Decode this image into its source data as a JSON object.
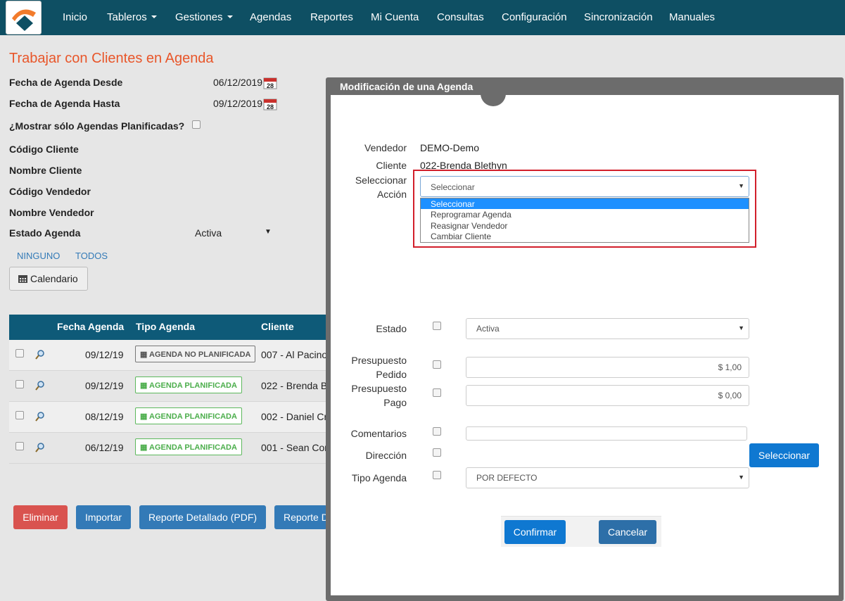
{
  "navbar": {
    "items": [
      {
        "label": "Inicio"
      },
      {
        "label": "Tableros",
        "dropdown": true
      },
      {
        "label": "Gestiones",
        "dropdown": true
      },
      {
        "label": "Agendas"
      },
      {
        "label": "Reportes"
      },
      {
        "label": "Mi Cuenta"
      },
      {
        "label": "Consultas"
      },
      {
        "label": "Configuración"
      },
      {
        "label": "Sincronización"
      },
      {
        "label": "Manuales"
      }
    ]
  },
  "page": {
    "title": "Trabajar con Clientes en Agenda",
    "filters": {
      "fecha_desde_label": "Fecha de Agenda Desde",
      "fecha_desde_value": "06/12/2019",
      "fecha_hasta_label": "Fecha de Agenda Hasta",
      "fecha_hasta_value": "09/12/2019",
      "solo_planificadas_label": "¿Mostrar sólo Agendas Planificadas?",
      "codigo_cliente_label": "Código Cliente",
      "nombre_cliente_label": "Nombre Cliente",
      "codigo_vendedor_label": "Código Vendedor",
      "nombre_vendedor_label": "Nombre Vendedor",
      "estado_agenda_label": "Estado Agenda",
      "estado_agenda_value": "Activa",
      "calendar_day": "28"
    },
    "ninguno_label": "NINGUNO",
    "todos_label": "TODOS",
    "calendario_label": "Calendario"
  },
  "table": {
    "headers": [
      "Fecha Agenda",
      "Tipo Agenda",
      "Cliente"
    ],
    "rows": [
      {
        "fecha": "09/12/19",
        "tipo": "AGENDA NO PLANIFICADA",
        "cliente": "007 - Al Pacino",
        "planned": false
      },
      {
        "fecha": "09/12/19",
        "tipo": "AGENDA PLANIFICADA",
        "cliente": "022 - Brenda B",
        "planned": true
      },
      {
        "fecha": "08/12/19",
        "tipo": "AGENDA PLANIFICADA",
        "cliente": "002 - Daniel Cr",
        "planned": true
      },
      {
        "fecha": "06/12/19",
        "tipo": "AGENDA PLANIFICADA",
        "cliente": "001 - Sean Cor",
        "planned": true
      }
    ]
  },
  "actions": {
    "eliminar": "Eliminar",
    "importar": "Importar",
    "reporte_pdf": "Reporte Detallado (PDF)",
    "reporte_d": "Reporte D"
  },
  "modal": {
    "title": "Modificación de una Agenda",
    "vendedor_label": "Vendedor",
    "vendedor_value": "DEMO-Demo",
    "cliente_label": "Cliente",
    "cliente_value": "022-Brenda Blethyn",
    "accion_label_1": "Seleccionar",
    "accion_label_2": "Acción",
    "accion_selected": "Seleccionar",
    "accion_options": [
      "Seleccionar",
      "Reprogramar Agenda",
      "Reasignar Vendedor",
      "Cambiar Cliente"
    ],
    "estado_label": "Estado",
    "estado_value": "Activa",
    "presupuesto_pedido_label_1": "Presupuesto",
    "presupuesto_pedido_label_2": "Pedido",
    "presupuesto_pedido_value": "$ 1,00",
    "presupuesto_pago_label_1": "Presupuesto",
    "presupuesto_pago_label_2": "Pago",
    "presupuesto_pago_value": "$ 0,00",
    "comentarios_label": "Comentarios",
    "direccion_label": "Dirección",
    "direccion_button": "Seleccionar",
    "tipo_agenda_label": "Tipo Agenda",
    "tipo_agenda_value": "POR DEFECTO",
    "confirmar": "Confirmar",
    "cancelar": "Cancelar"
  },
  "colors": {
    "navbar": "#0e4f63",
    "title": "#e8562a",
    "table_header": "#0e5a78",
    "primary_button": "#0f78d1",
    "danger_button": "#d9534f",
    "highlight_frame": "#d21f2b"
  }
}
